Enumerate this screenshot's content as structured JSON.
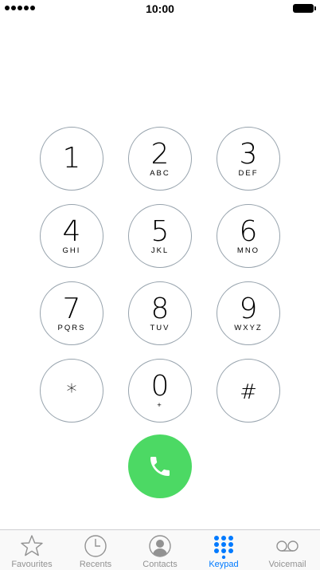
{
  "status_bar": {
    "time": "10:00",
    "signal_icon": "signal-dots-icon",
    "battery_icon": "battery-full-icon"
  },
  "keypad": {
    "keys": [
      {
        "digit": "1",
        "letters": ""
      },
      {
        "digit": "2",
        "letters": "ABC"
      },
      {
        "digit": "3",
        "letters": "DEF"
      },
      {
        "digit": "4",
        "letters": "GHI"
      },
      {
        "digit": "5",
        "letters": "JKL"
      },
      {
        "digit": "6",
        "letters": "MNO"
      },
      {
        "digit": "7",
        "letters": "PQRS"
      },
      {
        "digit": "8",
        "letters": "TUV"
      },
      {
        "digit": "9",
        "letters": "WXYZ"
      },
      {
        "digit": "*",
        "letters": ""
      },
      {
        "digit": "0",
        "letters": "+"
      },
      {
        "digit": "#",
        "letters": ""
      }
    ],
    "call_icon": "phone-handset-icon"
  },
  "tab_bar": {
    "tabs": [
      {
        "label": "Favourites",
        "icon": "star-icon",
        "active": false
      },
      {
        "label": "Recents",
        "icon": "clock-icon",
        "active": false
      },
      {
        "label": "Contacts",
        "icon": "contact-icon",
        "active": false
      },
      {
        "label": "Keypad",
        "icon": "keypad-grid-icon",
        "active": true
      },
      {
        "label": "Voicemail",
        "icon": "voicemail-icon",
        "active": false
      }
    ]
  },
  "colors": {
    "accent": "#007aff",
    "call_green": "#4cd964",
    "key_border": "#97a3ad",
    "inactive_tab": "#929292"
  }
}
